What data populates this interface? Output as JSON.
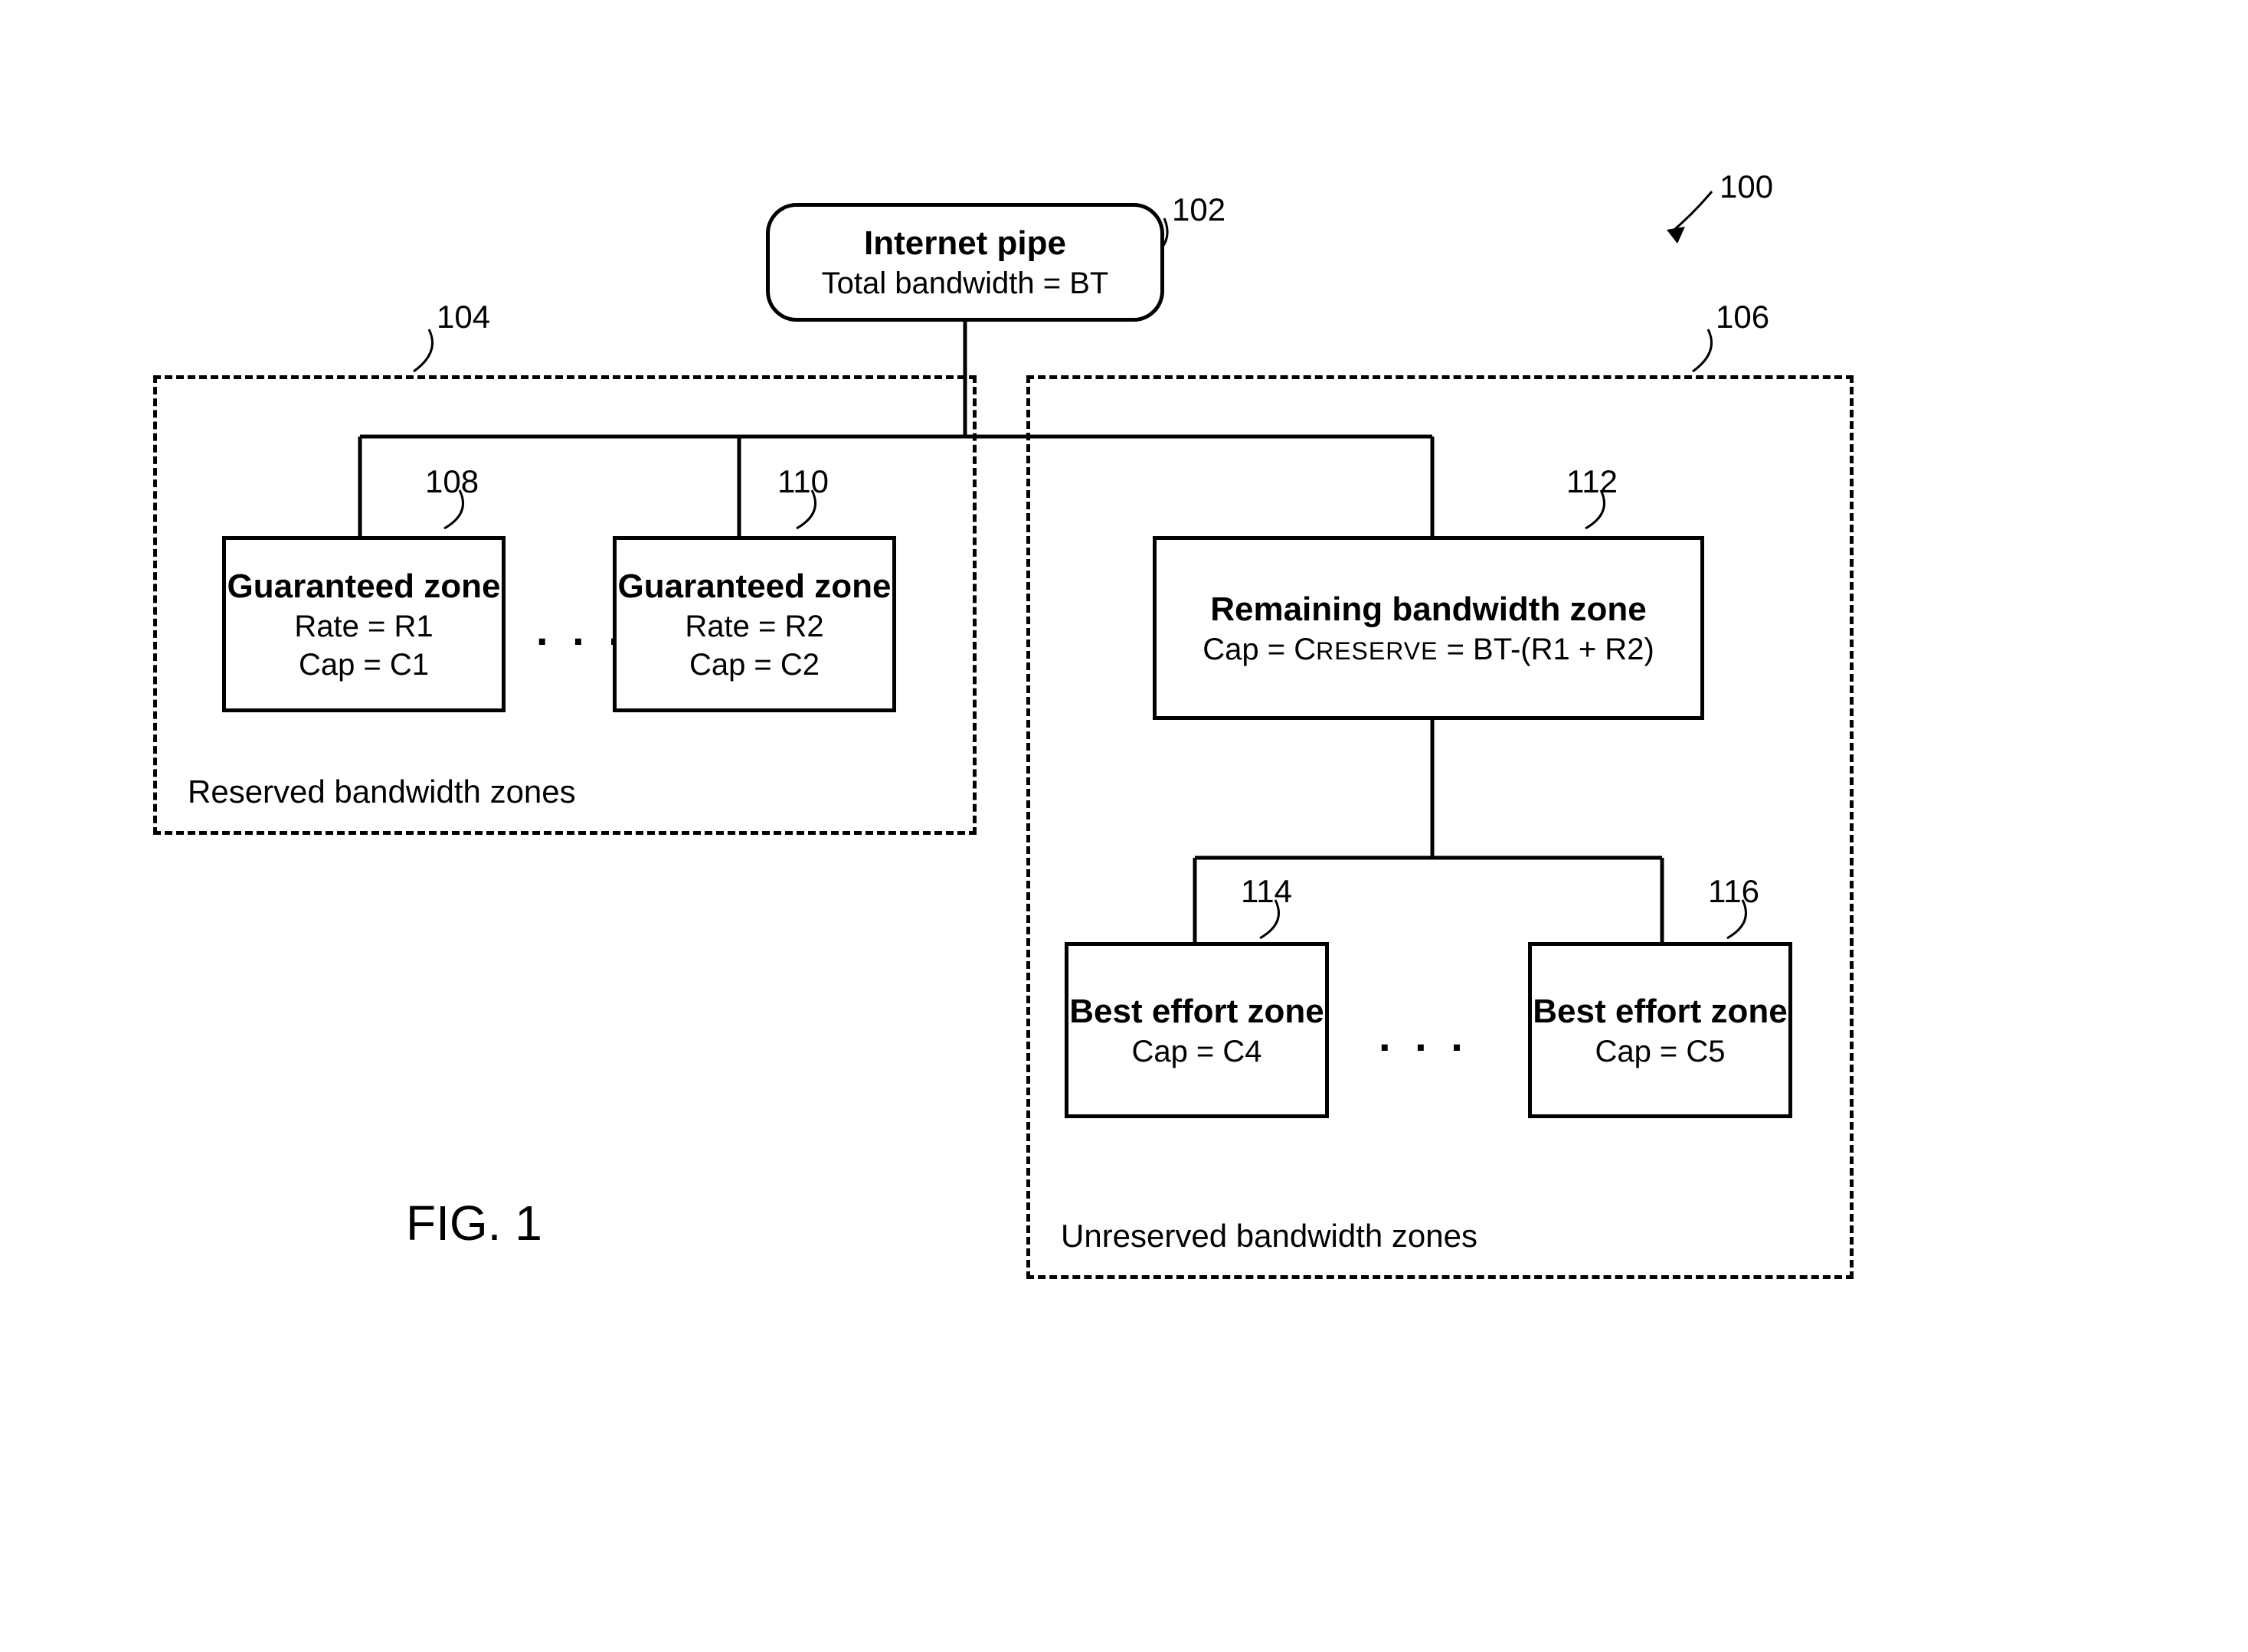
{
  "figure": {
    "label": "FIG. 1",
    "overall_ref": "100"
  },
  "root": {
    "ref": "102",
    "title": "Internet pipe",
    "sub": "Total bandwidth = BT"
  },
  "reserved_group": {
    "ref": "104",
    "caption": "Reserved bandwidth zones",
    "gz1": {
      "ref": "108",
      "title": "Guaranteed zone",
      "line1": "Rate = R1",
      "line2": "Cap = C1"
    },
    "gz2": {
      "ref": "110",
      "title": "Guaranteed zone",
      "line1": "Rate = R2",
      "line2": "Cap = C2"
    },
    "ellipsis": ". . ."
  },
  "unreserved_group": {
    "ref": "106",
    "caption": "Unreserved bandwidth zones",
    "remaining": {
      "ref": "112",
      "title": "Remaining bandwidth zone",
      "line_prefix": "Cap = C",
      "line_smallcaps": "RESERVE",
      "line_suffix": " = BT-(R1 + R2)"
    },
    "be1": {
      "ref": "114",
      "title": "Best effort zone",
      "line1": "Cap = C4"
    },
    "be2": {
      "ref": "116",
      "title": "Best effort zone",
      "line1": "Cap = C5"
    },
    "ellipsis": ". . ."
  }
}
